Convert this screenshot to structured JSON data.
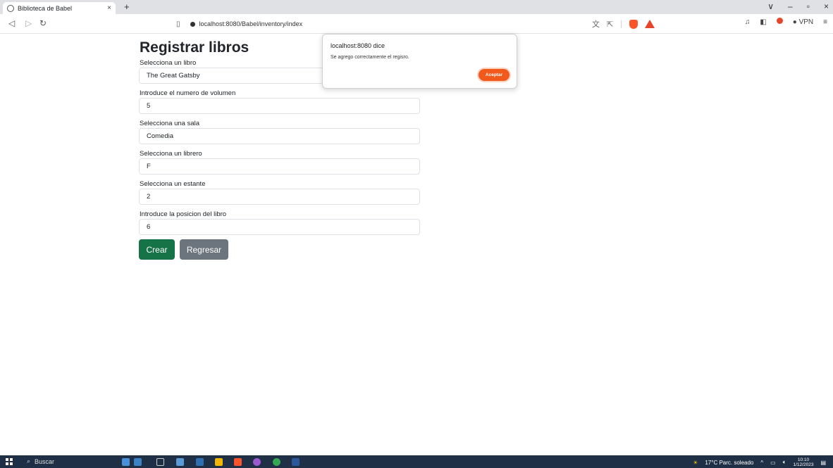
{
  "browser": {
    "tab_title": "Biblioteca de Babel",
    "tab_close": "×",
    "new_tab": "+",
    "url": "localhost:8080/Babel/inventory/index",
    "vpn_label": "VPN",
    "window_controls": [
      "∨",
      "–",
      "▫",
      "×"
    ]
  },
  "page": {
    "title": "Registrar libros",
    "fields": [
      {
        "label": "Selecciona un libro",
        "value": "The Great Gatsby"
      },
      {
        "label": "Introduce el numero de volumen",
        "value": "5"
      },
      {
        "label": "Selecciona una sala",
        "value": "Comedia"
      },
      {
        "label": "Selecciona un librero",
        "value": "F"
      },
      {
        "label": "Selecciona un estante",
        "value": "2"
      },
      {
        "label": "Introduce la posicion del libro",
        "value": "6"
      }
    ],
    "create_button": "Crear",
    "back_button": "Regresar"
  },
  "dialog": {
    "title": "localhost:8080 dice",
    "message": "Se agrego correctamente el regisro.",
    "ok_button": "Aceptar"
  },
  "taskbar": {
    "search_label": "Buscar",
    "weather": "17°C  Parc. soleado",
    "time": "10:10",
    "date": "1/12/2023"
  },
  "colors": {
    "create_button": "#157347",
    "back_button": "#6c757d",
    "dialog_accent": "#f25a1d",
    "taskbar": "#1f2f46"
  }
}
